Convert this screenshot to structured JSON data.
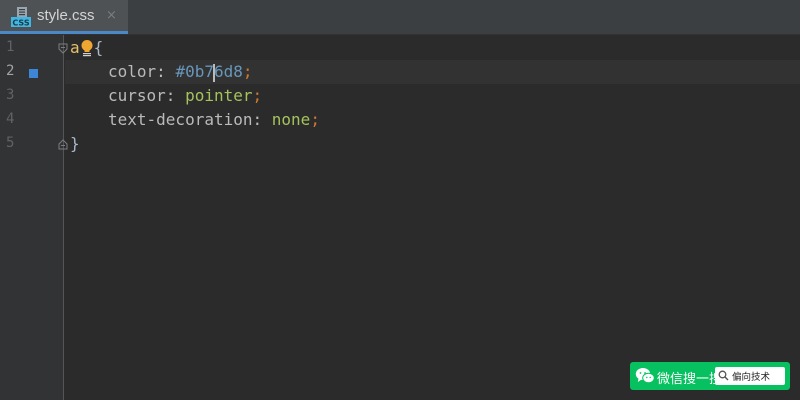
{
  "tab": {
    "file_name": "style.css",
    "close_glyph": "×",
    "file_icon_label": "CSS",
    "icon": "css-file-icon"
  },
  "gutter": {
    "line_numbers": [
      "1",
      "2",
      "3",
      "4",
      "5"
    ],
    "active_line": 2
  },
  "code": {
    "line1": {
      "selector": "a",
      "brace": "{"
    },
    "line2": {
      "property": "color",
      "colon": ":",
      "value_before_caret": "#0b7",
      "value_after_caret": "6d8",
      "semicolon": ";"
    },
    "line3": {
      "property": "cursor",
      "colon": ":",
      "value": "pointer",
      "semicolon": ";"
    },
    "line4": {
      "property": "text-decoration",
      "colon": ":",
      "value": "none",
      "semicolon": ";"
    },
    "line5": {
      "brace": "}"
    }
  },
  "colors": {
    "background": "#2b2b2b",
    "gutter": "#313335",
    "tab_accent": "#4a88c7",
    "change_marker": "#3d85d6",
    "selector": "#e8bf6a",
    "keyword_punct": "#cc7832",
    "number": "#6897bb",
    "string_value": "#a5c25c",
    "wechat_green": "#07c160"
  },
  "watermark": {
    "label": "微信搜一搜",
    "search_text": "偏向技术",
    "icon": "wechat-logo-icon"
  }
}
